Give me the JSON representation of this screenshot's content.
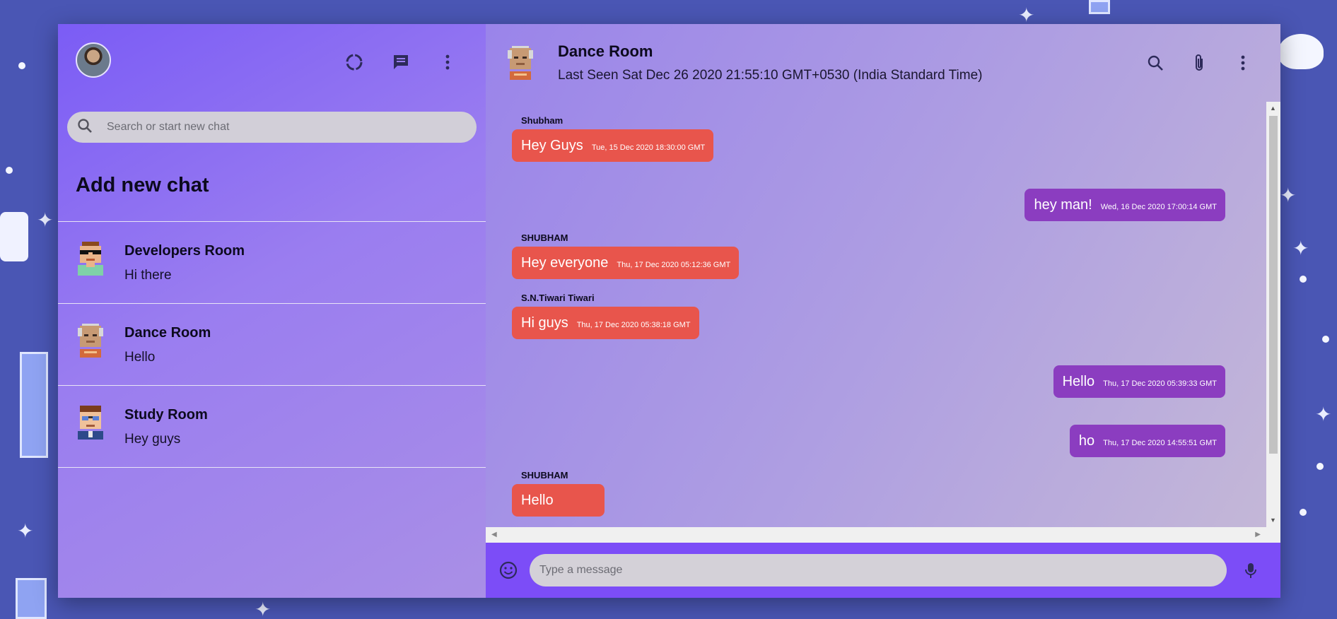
{
  "sidebar": {
    "search": {
      "placeholder": "Search or start new chat"
    },
    "add_new_chat": "Add new chat",
    "header_icons": [
      "status-icon",
      "new-chat-icon",
      "more-vert-icon"
    ],
    "chats": [
      {
        "name": "Developers Room",
        "last_message": "Hi there",
        "avatar": "sunglasses-avatar"
      },
      {
        "name": "Dance Room",
        "last_message": "Hello",
        "avatar": "bald-avatar"
      },
      {
        "name": "Study Room",
        "last_message": "Hey guys",
        "avatar": "glasses-avatar"
      }
    ]
  },
  "chat": {
    "title": "Dance Room",
    "subtitle": "Last Seen Sat Dec 26 2020 21:55:10 GMT+0530 (India Standard Time)",
    "header_icons": [
      "search-icon",
      "attach-icon",
      "more-vert-icon"
    ],
    "messages": [
      {
        "direction": "received",
        "sender": "Shubham",
        "text": "Hey Guys",
        "time": "Tue, 15 Dec 2020 18:30:00 GMT"
      },
      {
        "direction": "sent",
        "sender": "",
        "text": "hey man!",
        "time": "Wed, 16 Dec 2020 17:00:14 GMT"
      },
      {
        "direction": "received",
        "sender": "SHUBHAM",
        "text": "Hey everyone",
        "time": "Thu, 17 Dec 2020 05:12:36 GMT"
      },
      {
        "direction": "received",
        "sender": "S.N.Tiwari Tiwari",
        "text": "Hi guys",
        "time": "Thu, 17 Dec 2020 05:38:18 GMT"
      },
      {
        "direction": "sent",
        "sender": "",
        "text": "Hello",
        "time": "Thu, 17 Dec 2020 05:39:33 GMT"
      },
      {
        "direction": "sent",
        "sender": "",
        "text": "ho",
        "time": "Thu, 17 Dec 2020 14:55:51 GMT"
      },
      {
        "direction": "received",
        "sender": "SHUBHAM",
        "text": "Hello",
        "time": ""
      }
    ],
    "composer": {
      "placeholder": "Type a message"
    }
  },
  "colors": {
    "received_bubble": "#e8554c",
    "sent_bubble": "#8b3dc0",
    "composer_bar": "#7c4df7",
    "sidebar_gradient_start": "#7b5cf5"
  }
}
